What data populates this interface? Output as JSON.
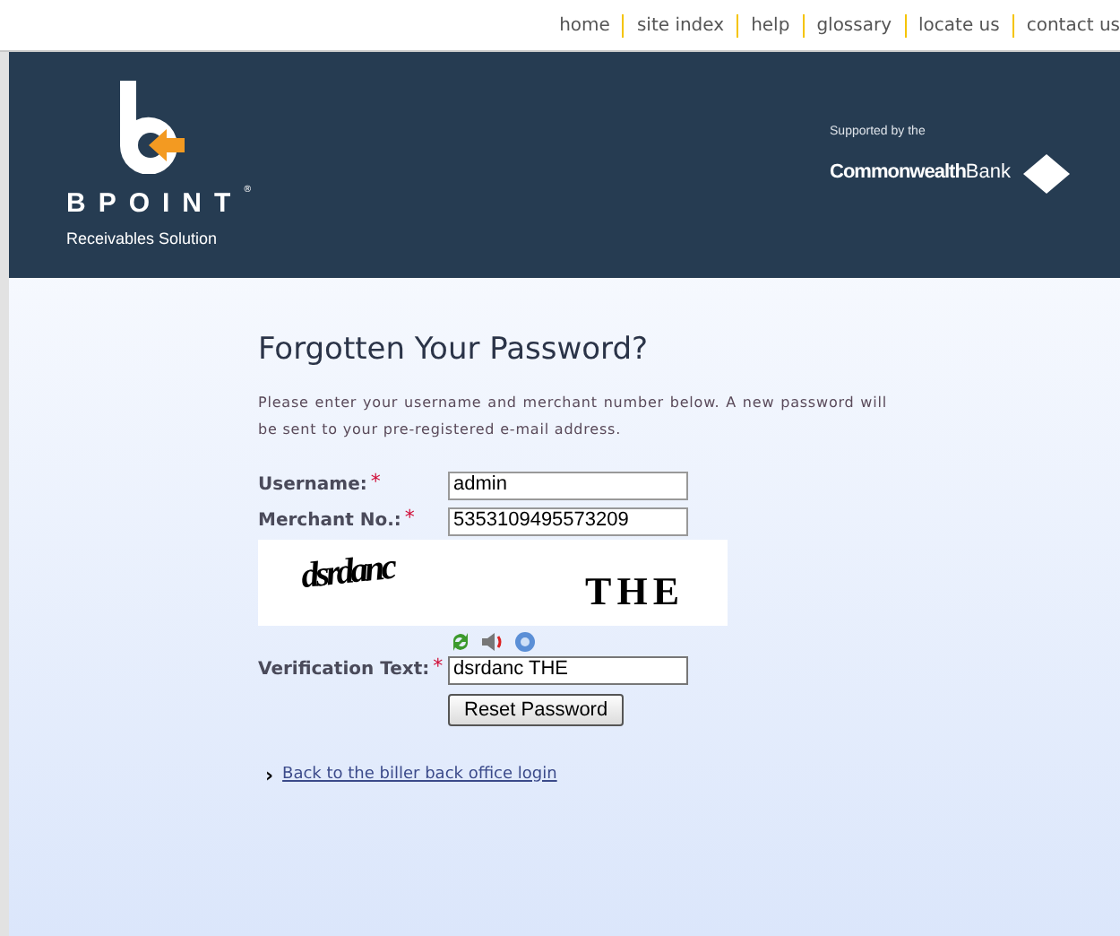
{
  "top_nav": [
    "home",
    "site index",
    "help",
    "glossary",
    "locate us",
    "contact us"
  ],
  "header": {
    "brand": "BPOINT",
    "brand_mark": "®",
    "tagline": "Receivables Solution",
    "supported_by": "Supported by the",
    "bank_bold": "Commonwealth",
    "bank_light": "Bank"
  },
  "title": "Forgotten Your Password?",
  "intro": "Please enter your username and merchant number below. A new password will be sent to your pre-registered e-mail address.",
  "fields": [
    {
      "label": "Username:",
      "required_mark": "*",
      "value": "admin"
    },
    {
      "label": "Merchant No.:",
      "required_mark": "*",
      "value": "5353109495573209"
    }
  ],
  "captcha": {
    "words": [
      "dsrdanc",
      "THE"
    ]
  },
  "verification": {
    "label": "Verification Text:",
    "required_mark": "*",
    "value": "dsrdanc THE"
  },
  "submit": "Reset Password",
  "back_link": {
    "marker": "›",
    "label": "Back to the biller back office login"
  }
}
